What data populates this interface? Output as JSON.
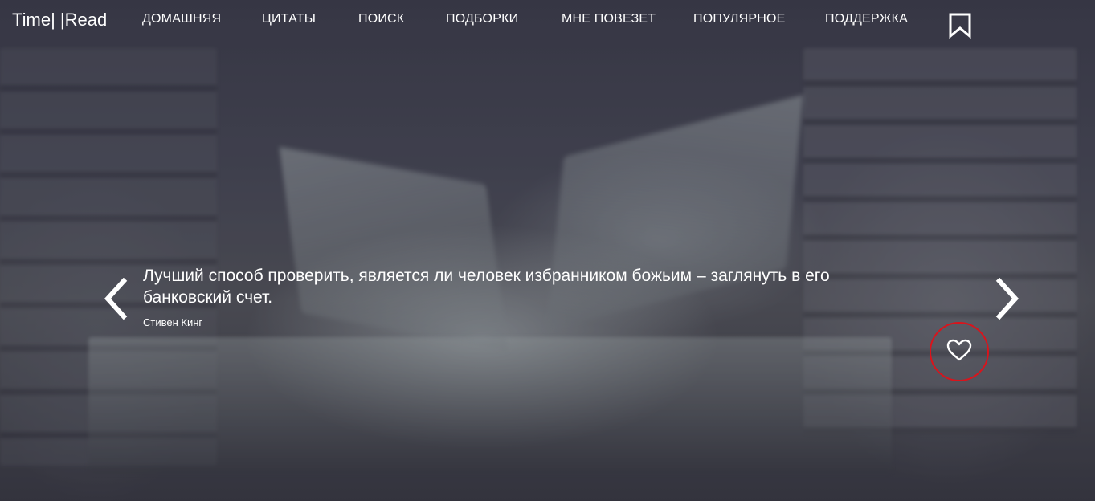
{
  "brand": "Time| |Read",
  "nav": {
    "items": [
      {
        "label": "ДОМАШНЯЯ"
      },
      {
        "label": "ЦИТАТЫ"
      },
      {
        "label": "ПОИСК"
      },
      {
        "label": "ПОДБОРКИ"
      },
      {
        "label": "МНЕ ПОВЕЗЕТ"
      },
      {
        "label": "ПОПУЛЯРНОЕ"
      },
      {
        "label": "ПОДДЕРЖКА"
      }
    ],
    "bookmark_icon": "bookmark-icon"
  },
  "slide": {
    "quote": "Лучший способ проверить, является ли человек избранником божьим – заглянуть в его банковский счет.",
    "author": "Стивен Кинг",
    "prev_icon": "chevron-left-icon",
    "next_icon": "chevron-right-icon",
    "like_icon": "heart-icon"
  },
  "colors": {
    "text": "#ffffff",
    "like_ring": "#d9141c",
    "background": "#4a4b5a"
  }
}
